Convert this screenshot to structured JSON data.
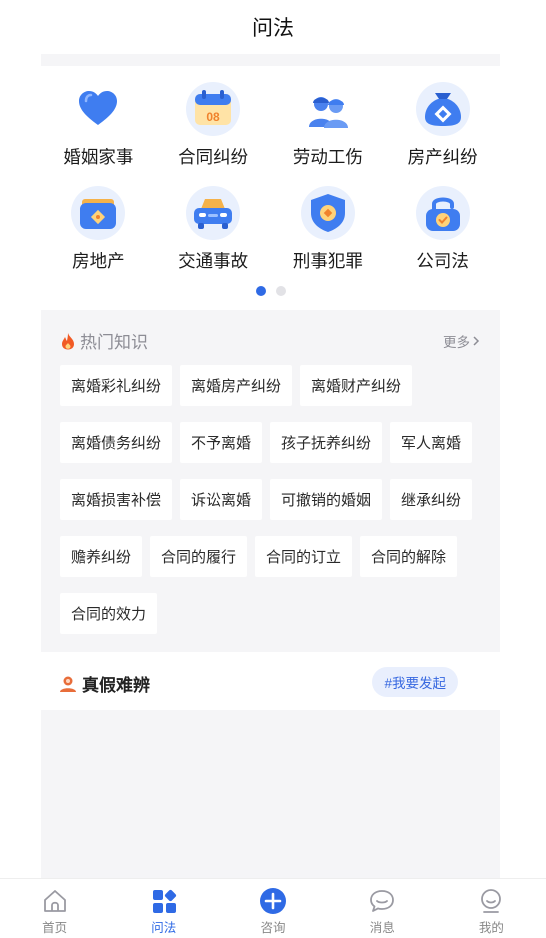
{
  "header": {
    "title": "问法"
  },
  "categories": [
    {
      "label": "婚姻家事",
      "icon": "heart-icon"
    },
    {
      "label": "合同纠纷",
      "icon": "calendar-icon",
      "badge": "08"
    },
    {
      "label": "劳动工伤",
      "icon": "workers-icon"
    },
    {
      "label": "房产纠纷",
      "icon": "money-bag-icon"
    },
    {
      "label": "房地产",
      "icon": "wallet-icon"
    },
    {
      "label": "交通事故",
      "icon": "car-icon"
    },
    {
      "label": "刑事犯罪",
      "icon": "shield-icon"
    },
    {
      "label": "公司法",
      "icon": "lock-icon"
    }
  ],
  "pager": {
    "pages": 2,
    "active": 0
  },
  "hot": {
    "title": "热门知识",
    "more": "更多",
    "tags": [
      "离婚彩礼纠纷",
      "离婚房产纠纷",
      "离婚财产纠纷",
      "离婚债务纠纷",
      "不予离婚",
      "孩子抚养纠纷",
      "军人离婚",
      "离婚损害补偿",
      "诉讼离婚",
      "可撤销的婚姻",
      "继承纠纷",
      "赡养纠纷",
      "合同的履行",
      "合同的订立",
      "合同的解除",
      "合同的效力"
    ]
  },
  "truth": {
    "title": "真假难辨",
    "button": "#我要发起"
  },
  "tabs": [
    {
      "label": "首页",
      "icon": "home-icon"
    },
    {
      "label": "问法",
      "icon": "grid-icon",
      "active": true
    },
    {
      "label": "咨询",
      "icon": "plus-circle-icon"
    },
    {
      "label": "消息",
      "icon": "message-icon"
    },
    {
      "label": "我的",
      "icon": "profile-icon"
    }
  ],
  "colors": {
    "accent": "#2f6ae5",
    "panel": "#f5f5f7",
    "hot_icon": "#f15a24",
    "truth_icon": "#e86d3a"
  }
}
